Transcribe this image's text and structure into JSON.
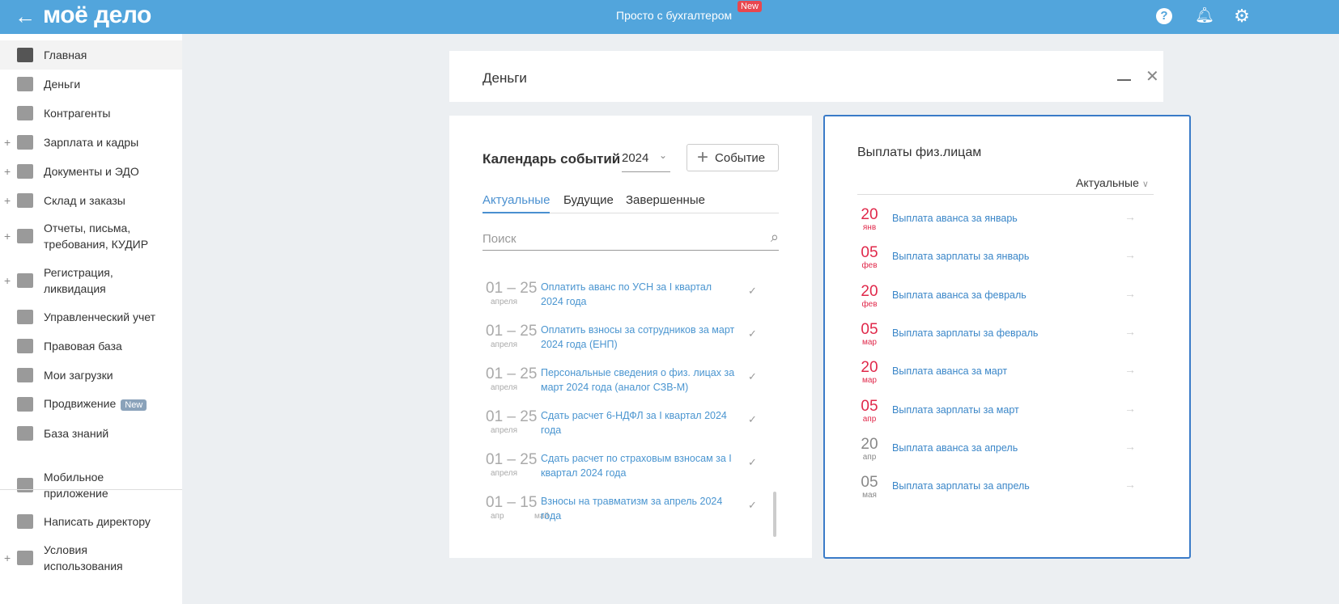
{
  "header": {
    "logo": "моё дело",
    "center_title": "Просто с бухгалтером",
    "new_badge": "New"
  },
  "sidebar": {
    "items": [
      {
        "label": "Главная",
        "icon": "home-icon",
        "active": true,
        "expand": false
      },
      {
        "label": "Деньги",
        "icon": "money-icon",
        "expand": false
      },
      {
        "label": "Контрагенты",
        "icon": "contractor-icon",
        "expand": false
      },
      {
        "label": "Зарплата и кадры",
        "icon": "wallet-icon",
        "expand": true
      },
      {
        "label": "Документы и ЭДО",
        "icon": "folder-icon",
        "expand": true
      },
      {
        "label": "Склад и заказы",
        "icon": "cart-icon",
        "expand": true
      },
      {
        "label": "Отчеты, письма, требования, КУДИР",
        "icon": "report-icon",
        "expand": true
      },
      {
        "label": "Регистрация, ликвидация",
        "icon": "registration-icon",
        "expand": true
      },
      {
        "label": "Управленческий учет",
        "icon": "ruble-icon",
        "expand": false
      },
      {
        "label": "Правовая база",
        "icon": "briefcase-icon",
        "expand": false
      },
      {
        "label": "Мои загрузки",
        "icon": "folder-icon",
        "expand": false
      },
      {
        "label": "Продвижение",
        "icon": "chart-icon",
        "expand": false,
        "badge": "New"
      },
      {
        "label": "База знаний",
        "icon": "graduation-icon",
        "expand": false
      },
      {
        "label": "Мобильное приложение",
        "icon": "mobile-icon",
        "expand": false
      },
      {
        "label": "Написать директору",
        "icon": "chat-icon",
        "expand": false
      },
      {
        "label": "Условия использования",
        "icon": "more-icon",
        "expand": true
      }
    ]
  },
  "money": {
    "title": "Деньги"
  },
  "calendar": {
    "title": "Календарь событий",
    "year": "2024",
    "add_event": "Событие",
    "tabs": [
      "Актуальные",
      "Будущие",
      "Завершенные"
    ],
    "search_placeholder": "Поиск",
    "events": [
      {
        "from": "01",
        "to": "25",
        "month": "апреля",
        "text": "Оплатить аванс по УСН за I квартал 2024 года"
      },
      {
        "from": "01",
        "to": "25",
        "month": "апреля",
        "text": "Оплатить взносы за сотрудников за март 2024 года (ЕНП)"
      },
      {
        "from": "01",
        "to": "25",
        "month": "апреля",
        "text": "Персональные сведения о физ. лицах за март 2024 года (аналог СЗВ-М)"
      },
      {
        "from": "01",
        "to": "25",
        "month": "апреля",
        "text": "Сдать расчет 6-НДФЛ за I квартал 2024 года"
      },
      {
        "from": "01",
        "to": "25",
        "month": "апреля",
        "text": "Сдать расчет по страховым взносам за I квартал 2024 года"
      },
      {
        "from": "01",
        "to": "15",
        "month": "апр",
        "month2": "май",
        "text": "Взносы на травматизм за апрель 2024 года"
      }
    ]
  },
  "payments": {
    "title": "Выплаты физ.лицам",
    "filter": "Актуальные",
    "items": [
      {
        "day": "20",
        "month": "янв",
        "text": "Выплата аванса за январь",
        "overdue": true
      },
      {
        "day": "05",
        "month": "фев",
        "text": "Выплата зарплаты за январь",
        "overdue": true
      },
      {
        "day": "20",
        "month": "фев",
        "text": "Выплата аванса за февраль",
        "overdue": true
      },
      {
        "day": "05",
        "month": "мар",
        "text": "Выплата зарплаты за февраль",
        "overdue": true
      },
      {
        "day": "20",
        "month": "мар",
        "text": "Выплата аванса за март",
        "overdue": true
      },
      {
        "day": "05",
        "month": "апр",
        "text": "Выплата зарплаты за март",
        "overdue": true
      },
      {
        "day": "20",
        "month": "апр",
        "text": "Выплата аванса за апрель",
        "overdue": false
      },
      {
        "day": "05",
        "month": "мая",
        "text": "Выплата зарплаты за апрель",
        "overdue": false
      }
    ]
  },
  "colors": {
    "header": "#52a5dc",
    "overdue": "#e0284a",
    "normal": "#888888",
    "link": "#3a86c8",
    "accent_border": "#3a7bc8"
  }
}
